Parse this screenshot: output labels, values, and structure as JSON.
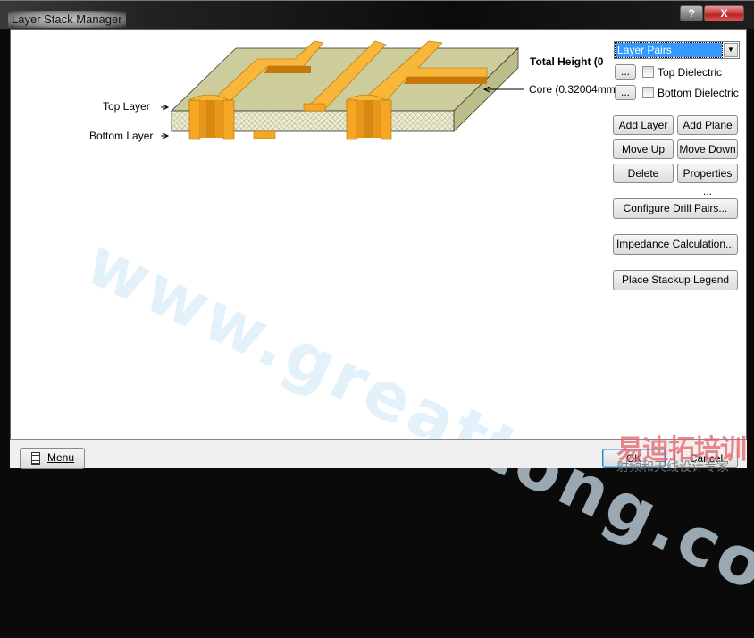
{
  "window": {
    "title": "Layer Stack Manager",
    "help_label": "?",
    "close_label": "X"
  },
  "diagram": {
    "top_layer_label": "Top Layer",
    "bottom_layer_label": "Bottom Layer",
    "total_height_label": "Total Height (0",
    "core_label": "Core (0.32004mm",
    "colors": {
      "board": "#cfcf9f",
      "copper": "#f5a623",
      "dielectric": "#e6e6c8"
    }
  },
  "controls": {
    "dropdown_value": "Layer Pairs",
    "top_dielectric": {
      "button": "...",
      "label": "Top Dielectric",
      "checked": false
    },
    "bottom_dielectric": {
      "button": "...",
      "label": "Bottom Dielectric",
      "checked": false
    },
    "add_layer": "Add Layer",
    "add_plane": "Add Plane",
    "move_up": "Move Up",
    "move_down": "Move Down",
    "delete": "Delete",
    "properties": "Properties ...",
    "configure_drill_pairs": "Configure Drill Pairs...",
    "impedance_calculation": "Impedance Calculation...",
    "place_stackup_legend": "Place Stackup Legend"
  },
  "footer": {
    "menu": "Menu",
    "ok": "OK",
    "cancel": "Cancel"
  },
  "watermarks": {
    "url": "www.greattong.com",
    "logo": "易迪拓培训",
    "logo_sub": "射频和天线设计专家"
  }
}
